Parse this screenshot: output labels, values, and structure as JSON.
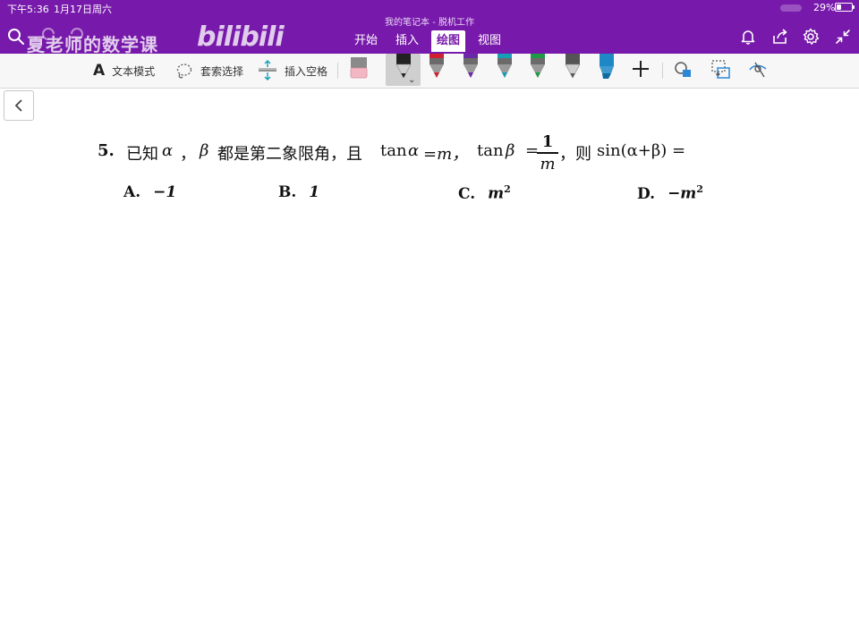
{
  "status": {
    "time": "下午5:36",
    "date": "1月17日周六",
    "battery": "29%",
    "battery_level": 0.29
  },
  "window_title": "我的笔记本 - 脱机工作",
  "watermark": {
    "channel": "夏老师的数学课",
    "logo": "bilibili"
  },
  "ribbon_tabs": [
    {
      "label": "开始"
    },
    {
      "label": "插入"
    },
    {
      "label": "绘图",
      "active": true
    },
    {
      "label": "视图"
    }
  ],
  "toolbar": {
    "text_mode_glyph": "A",
    "text_mode_label": "文本模式",
    "lasso_label": "套索选择",
    "insert_space_label": "插入空格",
    "plus_glyph": "+"
  },
  "pens": [
    {
      "name": "pencil-black",
      "color": "#222222",
      "selected": true
    },
    {
      "name": "pen-red",
      "color": "#d0202e"
    },
    {
      "name": "pen-purple",
      "color": "#6a2aa6"
    },
    {
      "name": "pen-teal",
      "color": "#16a0b8"
    },
    {
      "name": "pen-green",
      "color": "#1f9a45"
    },
    {
      "name": "pencil-gray",
      "color": "#555555"
    },
    {
      "name": "highlighter-blue",
      "color": "#1e88c7"
    }
  ],
  "colors": {
    "header": "#7719aa",
    "toolbar": "#f7f7f7"
  },
  "question": {
    "number": "5.",
    "part1": "已知",
    "alpha": "α",
    "comma1": "，",
    "beta": "β",
    "part2": "都是第二象限角，且",
    "tan": "tan",
    "eq_m": "=m，",
    "tan2": "tan",
    "eq": "=",
    "frac_num": "1",
    "frac_den": "m",
    "part3": "，则",
    "tail": "sin(α+β) ="
  },
  "options": [
    {
      "letter": "A.",
      "value": "−1",
      "sup": ""
    },
    {
      "letter": "B.",
      "value": "1",
      "sup": ""
    },
    {
      "letter": "C.",
      "value": "m",
      "sup": "2"
    },
    {
      "letter": "D.",
      "value": "−m",
      "sup": "2"
    }
  ]
}
